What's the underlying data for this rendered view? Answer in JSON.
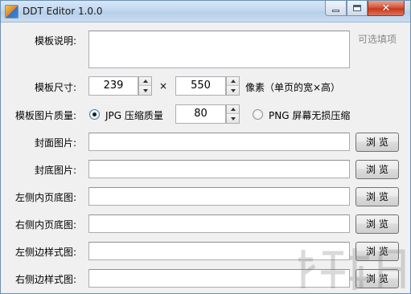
{
  "window": {
    "title": "DDT Editor 1.0.0",
    "controls": {
      "minimize": "minimize",
      "maximize": "maximize",
      "close": "✕"
    }
  },
  "form": {
    "description": {
      "label": "模板说明:",
      "value": "",
      "hint": "可选填项"
    },
    "size": {
      "label": "模板尺寸:",
      "width": "239",
      "separator": "×",
      "height": "550",
      "unit_note": "像素（单页的宽×高）"
    },
    "quality": {
      "label": "模板图片质量:",
      "jpg_option": "JPG 压缩质量",
      "jpg_selected": true,
      "jpg_value": "80",
      "png_option": "PNG 屏幕无损压缩"
    },
    "files": [
      {
        "label": "封面图片:",
        "value": "",
        "button": "浏览"
      },
      {
        "label": "封底图片:",
        "value": "",
        "button": "浏览"
      },
      {
        "label": "左侧内页底图:",
        "value": "",
        "button": "浏览"
      },
      {
        "label": "右侧内页底图:",
        "value": "",
        "button": "浏览"
      },
      {
        "label": "左侧边样式图:",
        "value": "",
        "button": "浏览"
      },
      {
        "label": "右侧边样式图:",
        "value": "",
        "button": "浏览"
      }
    ]
  },
  "colors": {
    "titlebar": "#c2d8ef",
    "window_bg": "#f0f0f0",
    "close_button": "#c7391c"
  }
}
